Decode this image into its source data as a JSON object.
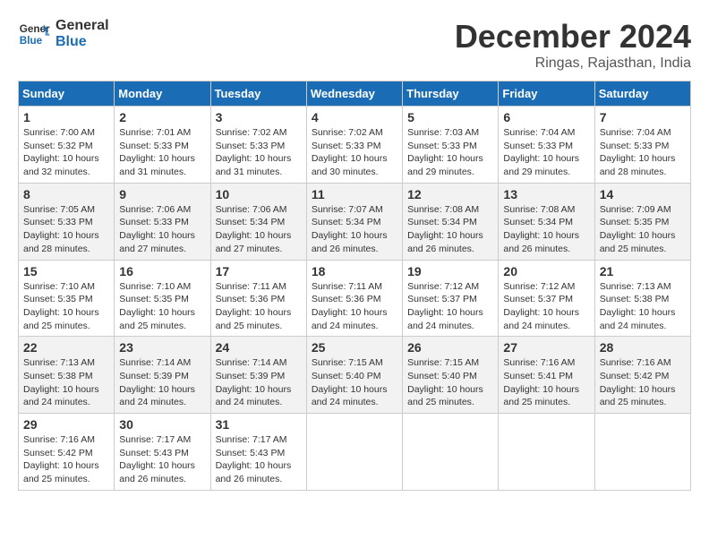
{
  "header": {
    "logo_line1": "General",
    "logo_line2": "Blue",
    "title": "December 2024",
    "subtitle": "Ringas, Rajasthan, India"
  },
  "columns": [
    "Sunday",
    "Monday",
    "Tuesday",
    "Wednesday",
    "Thursday",
    "Friday",
    "Saturday"
  ],
  "weeks": [
    {
      "days": [
        {
          "num": "1",
          "info": "Sunrise: 7:00 AM\nSunset: 5:32 PM\nDaylight: 10 hours\nand 32 minutes."
        },
        {
          "num": "2",
          "info": "Sunrise: 7:01 AM\nSunset: 5:33 PM\nDaylight: 10 hours\nand 31 minutes."
        },
        {
          "num": "3",
          "info": "Sunrise: 7:02 AM\nSunset: 5:33 PM\nDaylight: 10 hours\nand 31 minutes."
        },
        {
          "num": "4",
          "info": "Sunrise: 7:02 AM\nSunset: 5:33 PM\nDaylight: 10 hours\nand 30 minutes."
        },
        {
          "num": "5",
          "info": "Sunrise: 7:03 AM\nSunset: 5:33 PM\nDaylight: 10 hours\nand 29 minutes."
        },
        {
          "num": "6",
          "info": "Sunrise: 7:04 AM\nSunset: 5:33 PM\nDaylight: 10 hours\nand 29 minutes."
        },
        {
          "num": "7",
          "info": "Sunrise: 7:04 AM\nSunset: 5:33 PM\nDaylight: 10 hours\nand 28 minutes."
        }
      ]
    },
    {
      "days": [
        {
          "num": "8",
          "info": "Sunrise: 7:05 AM\nSunset: 5:33 PM\nDaylight: 10 hours\nand 28 minutes."
        },
        {
          "num": "9",
          "info": "Sunrise: 7:06 AM\nSunset: 5:33 PM\nDaylight: 10 hours\nand 27 minutes."
        },
        {
          "num": "10",
          "info": "Sunrise: 7:06 AM\nSunset: 5:34 PM\nDaylight: 10 hours\nand 27 minutes."
        },
        {
          "num": "11",
          "info": "Sunrise: 7:07 AM\nSunset: 5:34 PM\nDaylight: 10 hours\nand 26 minutes."
        },
        {
          "num": "12",
          "info": "Sunrise: 7:08 AM\nSunset: 5:34 PM\nDaylight: 10 hours\nand 26 minutes."
        },
        {
          "num": "13",
          "info": "Sunrise: 7:08 AM\nSunset: 5:34 PM\nDaylight: 10 hours\nand 26 minutes."
        },
        {
          "num": "14",
          "info": "Sunrise: 7:09 AM\nSunset: 5:35 PM\nDaylight: 10 hours\nand 25 minutes."
        }
      ]
    },
    {
      "days": [
        {
          "num": "15",
          "info": "Sunrise: 7:10 AM\nSunset: 5:35 PM\nDaylight: 10 hours\nand 25 minutes."
        },
        {
          "num": "16",
          "info": "Sunrise: 7:10 AM\nSunset: 5:35 PM\nDaylight: 10 hours\nand 25 minutes."
        },
        {
          "num": "17",
          "info": "Sunrise: 7:11 AM\nSunset: 5:36 PM\nDaylight: 10 hours\nand 25 minutes."
        },
        {
          "num": "18",
          "info": "Sunrise: 7:11 AM\nSunset: 5:36 PM\nDaylight: 10 hours\nand 24 minutes."
        },
        {
          "num": "19",
          "info": "Sunrise: 7:12 AM\nSunset: 5:37 PM\nDaylight: 10 hours\nand 24 minutes."
        },
        {
          "num": "20",
          "info": "Sunrise: 7:12 AM\nSunset: 5:37 PM\nDaylight: 10 hours\nand 24 minutes."
        },
        {
          "num": "21",
          "info": "Sunrise: 7:13 AM\nSunset: 5:38 PM\nDaylight: 10 hours\nand 24 minutes."
        }
      ]
    },
    {
      "days": [
        {
          "num": "22",
          "info": "Sunrise: 7:13 AM\nSunset: 5:38 PM\nDaylight: 10 hours\nand 24 minutes."
        },
        {
          "num": "23",
          "info": "Sunrise: 7:14 AM\nSunset: 5:39 PM\nDaylight: 10 hours\nand 24 minutes."
        },
        {
          "num": "24",
          "info": "Sunrise: 7:14 AM\nSunset: 5:39 PM\nDaylight: 10 hours\nand 24 minutes."
        },
        {
          "num": "25",
          "info": "Sunrise: 7:15 AM\nSunset: 5:40 PM\nDaylight: 10 hours\nand 24 minutes."
        },
        {
          "num": "26",
          "info": "Sunrise: 7:15 AM\nSunset: 5:40 PM\nDaylight: 10 hours\nand 25 minutes."
        },
        {
          "num": "27",
          "info": "Sunrise: 7:16 AM\nSunset: 5:41 PM\nDaylight: 10 hours\nand 25 minutes."
        },
        {
          "num": "28",
          "info": "Sunrise: 7:16 AM\nSunset: 5:42 PM\nDaylight: 10 hours\nand 25 minutes."
        }
      ]
    },
    {
      "days": [
        {
          "num": "29",
          "info": "Sunrise: 7:16 AM\nSunset: 5:42 PM\nDaylight: 10 hours\nand 25 minutes."
        },
        {
          "num": "30",
          "info": "Sunrise: 7:17 AM\nSunset: 5:43 PM\nDaylight: 10 hours\nand 26 minutes."
        },
        {
          "num": "31",
          "info": "Sunrise: 7:17 AM\nSunset: 5:43 PM\nDaylight: 10 hours\nand 26 minutes."
        },
        {
          "num": "",
          "info": ""
        },
        {
          "num": "",
          "info": ""
        },
        {
          "num": "",
          "info": ""
        },
        {
          "num": "",
          "info": ""
        }
      ]
    }
  ]
}
